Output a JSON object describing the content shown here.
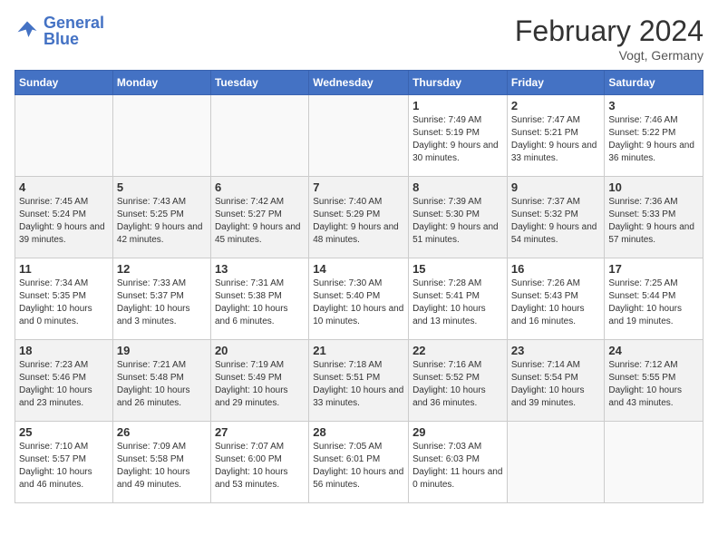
{
  "header": {
    "logo_general": "General",
    "logo_blue": "Blue",
    "month": "February 2024",
    "location": "Vogt, Germany"
  },
  "days_of_week": [
    "Sunday",
    "Monday",
    "Tuesday",
    "Wednesday",
    "Thursday",
    "Friday",
    "Saturday"
  ],
  "weeks": [
    [
      {
        "day": "",
        "info": ""
      },
      {
        "day": "",
        "info": ""
      },
      {
        "day": "",
        "info": ""
      },
      {
        "day": "",
        "info": ""
      },
      {
        "day": "1",
        "info": "Sunrise: 7:49 AM\nSunset: 5:19 PM\nDaylight: 9 hours\nand 30 minutes."
      },
      {
        "day": "2",
        "info": "Sunrise: 7:47 AM\nSunset: 5:21 PM\nDaylight: 9 hours\nand 33 minutes."
      },
      {
        "day": "3",
        "info": "Sunrise: 7:46 AM\nSunset: 5:22 PM\nDaylight: 9 hours\nand 36 minutes."
      }
    ],
    [
      {
        "day": "4",
        "info": "Sunrise: 7:45 AM\nSunset: 5:24 PM\nDaylight: 9 hours\nand 39 minutes."
      },
      {
        "day": "5",
        "info": "Sunrise: 7:43 AM\nSunset: 5:25 PM\nDaylight: 9 hours\nand 42 minutes."
      },
      {
        "day": "6",
        "info": "Sunrise: 7:42 AM\nSunset: 5:27 PM\nDaylight: 9 hours\nand 45 minutes."
      },
      {
        "day": "7",
        "info": "Sunrise: 7:40 AM\nSunset: 5:29 PM\nDaylight: 9 hours\nand 48 minutes."
      },
      {
        "day": "8",
        "info": "Sunrise: 7:39 AM\nSunset: 5:30 PM\nDaylight: 9 hours\nand 51 minutes."
      },
      {
        "day": "9",
        "info": "Sunrise: 7:37 AM\nSunset: 5:32 PM\nDaylight: 9 hours\nand 54 minutes."
      },
      {
        "day": "10",
        "info": "Sunrise: 7:36 AM\nSunset: 5:33 PM\nDaylight: 9 hours\nand 57 minutes."
      }
    ],
    [
      {
        "day": "11",
        "info": "Sunrise: 7:34 AM\nSunset: 5:35 PM\nDaylight: 10 hours\nand 0 minutes."
      },
      {
        "day": "12",
        "info": "Sunrise: 7:33 AM\nSunset: 5:37 PM\nDaylight: 10 hours\nand 3 minutes."
      },
      {
        "day": "13",
        "info": "Sunrise: 7:31 AM\nSunset: 5:38 PM\nDaylight: 10 hours\nand 6 minutes."
      },
      {
        "day": "14",
        "info": "Sunrise: 7:30 AM\nSunset: 5:40 PM\nDaylight: 10 hours\nand 10 minutes."
      },
      {
        "day": "15",
        "info": "Sunrise: 7:28 AM\nSunset: 5:41 PM\nDaylight: 10 hours\nand 13 minutes."
      },
      {
        "day": "16",
        "info": "Sunrise: 7:26 AM\nSunset: 5:43 PM\nDaylight: 10 hours\nand 16 minutes."
      },
      {
        "day": "17",
        "info": "Sunrise: 7:25 AM\nSunset: 5:44 PM\nDaylight: 10 hours\nand 19 minutes."
      }
    ],
    [
      {
        "day": "18",
        "info": "Sunrise: 7:23 AM\nSunset: 5:46 PM\nDaylight: 10 hours\nand 23 minutes."
      },
      {
        "day": "19",
        "info": "Sunrise: 7:21 AM\nSunset: 5:48 PM\nDaylight: 10 hours\nand 26 minutes."
      },
      {
        "day": "20",
        "info": "Sunrise: 7:19 AM\nSunset: 5:49 PM\nDaylight: 10 hours\nand 29 minutes."
      },
      {
        "day": "21",
        "info": "Sunrise: 7:18 AM\nSunset: 5:51 PM\nDaylight: 10 hours\nand 33 minutes."
      },
      {
        "day": "22",
        "info": "Sunrise: 7:16 AM\nSunset: 5:52 PM\nDaylight: 10 hours\nand 36 minutes."
      },
      {
        "day": "23",
        "info": "Sunrise: 7:14 AM\nSunset: 5:54 PM\nDaylight: 10 hours\nand 39 minutes."
      },
      {
        "day": "24",
        "info": "Sunrise: 7:12 AM\nSunset: 5:55 PM\nDaylight: 10 hours\nand 43 minutes."
      }
    ],
    [
      {
        "day": "25",
        "info": "Sunrise: 7:10 AM\nSunset: 5:57 PM\nDaylight: 10 hours\nand 46 minutes."
      },
      {
        "day": "26",
        "info": "Sunrise: 7:09 AM\nSunset: 5:58 PM\nDaylight: 10 hours\nand 49 minutes."
      },
      {
        "day": "27",
        "info": "Sunrise: 7:07 AM\nSunset: 6:00 PM\nDaylight: 10 hours\nand 53 minutes."
      },
      {
        "day": "28",
        "info": "Sunrise: 7:05 AM\nSunset: 6:01 PM\nDaylight: 10 hours\nand 56 minutes."
      },
      {
        "day": "29",
        "info": "Sunrise: 7:03 AM\nSunset: 6:03 PM\nDaylight: 11 hours\nand 0 minutes."
      },
      {
        "day": "",
        "info": ""
      },
      {
        "day": "",
        "info": ""
      }
    ]
  ]
}
